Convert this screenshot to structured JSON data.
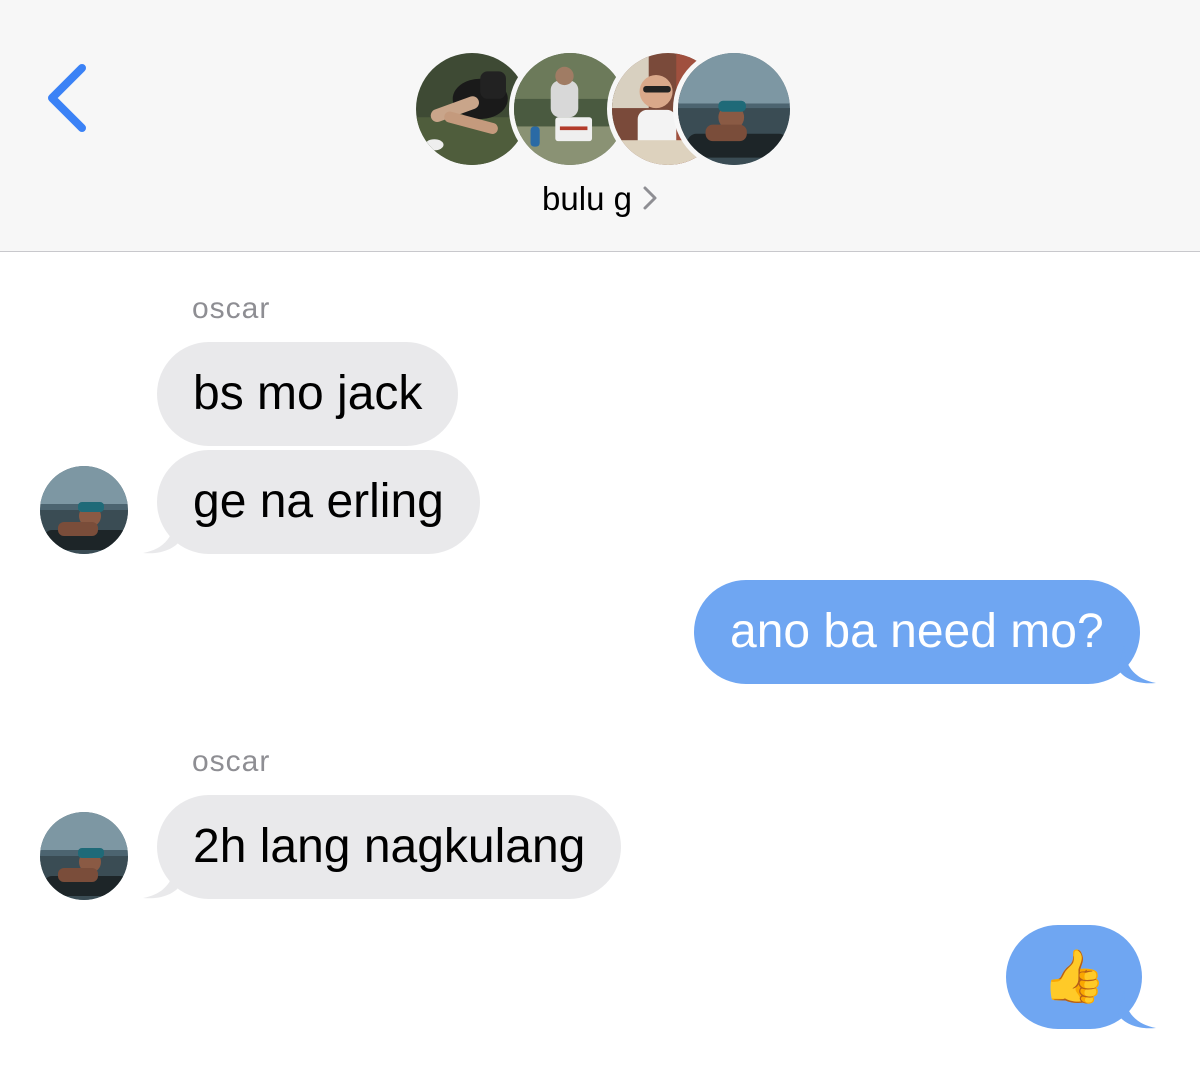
{
  "header": {
    "group_name": "bulu g",
    "back_icon": "chevron-left-icon",
    "disclosure_icon": "chevron-right-icon",
    "accent_color": "#3b82f6"
  },
  "messages": [
    {
      "sender": "oscar",
      "direction": "incoming",
      "text": "bs mo jack"
    },
    {
      "sender": "oscar",
      "direction": "incoming",
      "text": "ge na erling"
    },
    {
      "sender": "me",
      "direction": "outgoing",
      "text": "ano ba need mo?"
    },
    {
      "sender": "oscar",
      "direction": "incoming",
      "text": "2h lang nagkulang"
    },
    {
      "sender": "me",
      "direction": "outgoing",
      "text": "👍"
    }
  ],
  "colors": {
    "incoming_bubble": "#e9e9eb",
    "outgoing_bubble": "#6fa6f2",
    "sender_label": "#8e8e93"
  }
}
